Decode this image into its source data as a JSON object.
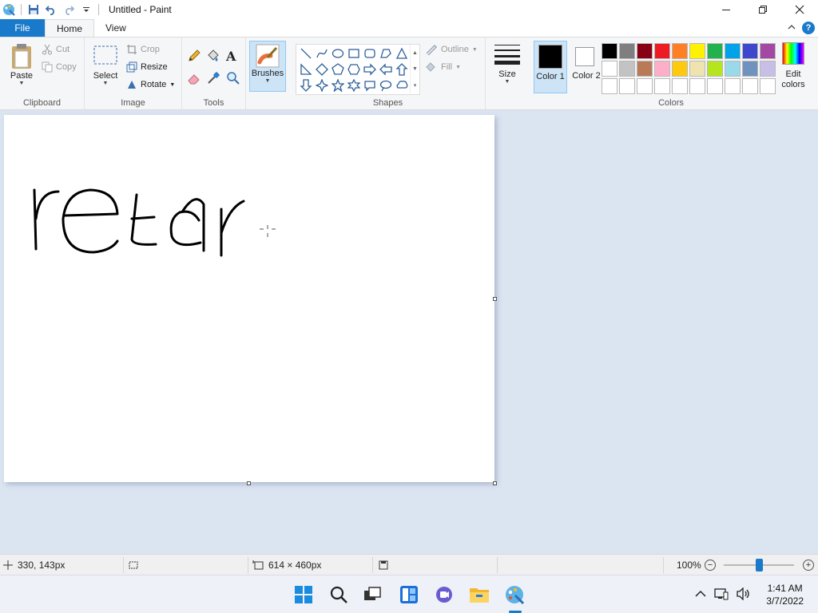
{
  "window": {
    "title": "Untitled - Paint",
    "controls": [
      "minimize",
      "restore",
      "close"
    ]
  },
  "tabs": [
    {
      "label": "File"
    },
    {
      "label": "Home",
      "active": true
    },
    {
      "label": "View"
    }
  ],
  "ribbon": {
    "clipboard": {
      "paste": "Paste",
      "cut": "Cut",
      "copy": "Copy",
      "group_label": "Clipboard"
    },
    "image": {
      "select": "Select",
      "crop": "Crop",
      "resize": "Resize",
      "rotate": "Rotate",
      "group_label": "Image"
    },
    "tools": {
      "group_label": "Tools",
      "icons": [
        "pencil-icon",
        "fill-icon",
        "text-icon",
        "eraser-icon",
        "color-picker-icon",
        "magnifier-icon"
      ]
    },
    "brushes": {
      "label": "Brushes"
    },
    "shapes": {
      "outline": "Outline",
      "fill": "Fill",
      "group_label": "Shapes"
    },
    "size": {
      "label": "Size"
    },
    "colors": {
      "color1_label": "Color 1",
      "color2_label": "Color 2",
      "edit_colors_label": "Edit colors",
      "group_label": "Colors",
      "color1": "#000000",
      "color2": "#ffffff",
      "palette_row1": [
        "#000000",
        "#7f7f7f",
        "#880015",
        "#ed1c24",
        "#ff7f27",
        "#fff200",
        "#22b14c",
        "#00a2e8",
        "#3f48cc",
        "#a349a4"
      ],
      "palette_row2": [
        "#ffffff",
        "#c3c3c3",
        "#b97a57",
        "#ffaec9",
        "#ffc90e",
        "#efe4b0",
        "#b5e61d",
        "#99d9ea",
        "#7092be",
        "#c8bfe7"
      ],
      "palette_row3": [
        "#ffffff",
        "#ffffff",
        "#ffffff",
        "#ffffff",
        "#ffffff",
        "#ffffff",
        "#ffffff",
        "#ffffff",
        "#ffffff",
        "#ffffff"
      ]
    }
  },
  "canvas": {
    "drawing_text": "retar"
  },
  "statusbar": {
    "cursor_position": "330, 143px",
    "canvas_size": "614 × 460px",
    "zoom": "100%"
  },
  "taskbar": {
    "time": "1:41 AM",
    "date": "3/7/2022"
  },
  "accent": "#1979ca"
}
